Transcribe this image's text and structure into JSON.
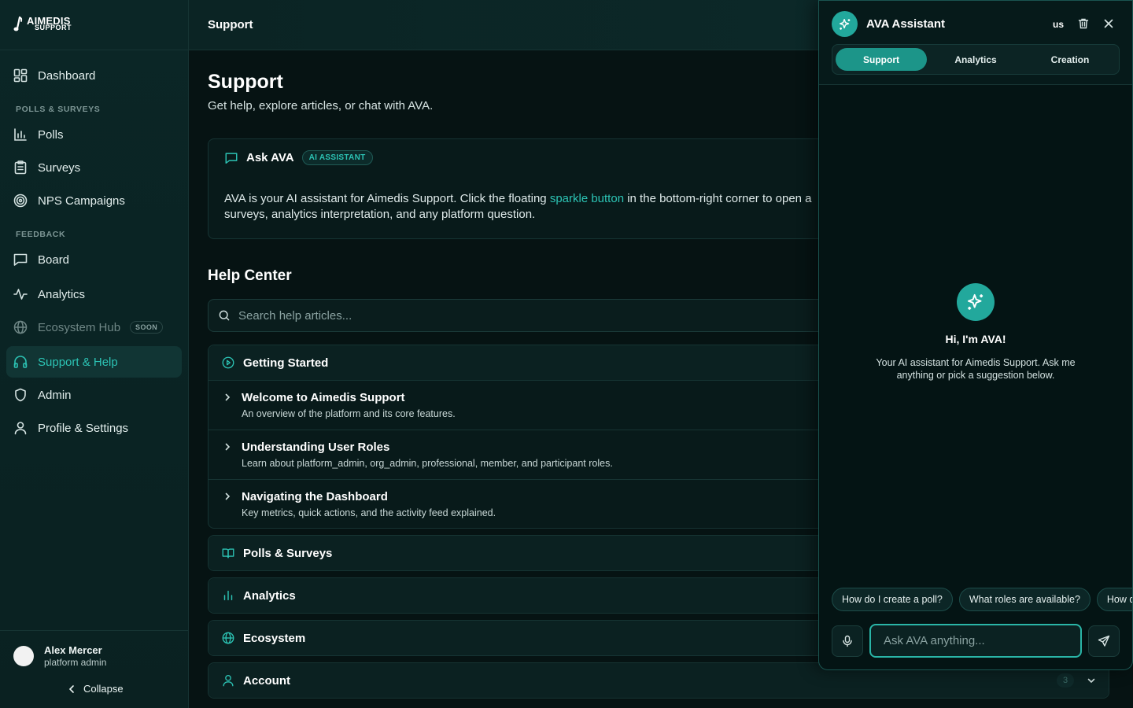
{
  "brand": {
    "line1": "AIMEDIS",
    "line2": "SUPPORT"
  },
  "sidebar": {
    "dashboard": "Dashboard",
    "section_polls": "POLLS & SURVEYS",
    "polls": "Polls",
    "surveys": "Surveys",
    "nps": "NPS Campaigns",
    "section_feedback": "FEEDBACK",
    "board": "Board",
    "analytics": "Analytics",
    "ecosystem": "Ecosystem Hub",
    "ecosystem_badge": "SOON",
    "support": "Support & Help",
    "admin": "Admin",
    "profile": "Profile & Settings"
  },
  "user": {
    "name": "Alex Mercer",
    "role": "platform admin"
  },
  "collapse_label": "Collapse",
  "topbar": {
    "title": "Support"
  },
  "page": {
    "title": "Support",
    "subtitle": "Get help, explore articles, or chat with AVA."
  },
  "ask": {
    "title": "Ask AVA",
    "badge": "AI ASSISTANT",
    "text_before": "AVA is your AI assistant for Aimedis Support. Click the floating ",
    "link": "sparkle button",
    "text_after": " in the bottom-right corner to open a",
    "line2": "surveys, analytics interpretation, and any platform question."
  },
  "help": {
    "title": "Help Center",
    "search_placeholder": "Search help articles...",
    "sections": [
      {
        "label": "Getting Started",
        "articles": [
          {
            "title": "Welcome to Aimedis Support",
            "desc": "An overview of the platform and its core features."
          },
          {
            "title": "Understanding User Roles",
            "desc": "Learn about platform_admin, org_admin, professional, member, and participant roles."
          },
          {
            "title": "Navigating the Dashboard",
            "desc": "Key metrics, quick actions, and the activity feed explained."
          }
        ]
      },
      {
        "label": "Polls & Surveys"
      },
      {
        "label": "Analytics"
      },
      {
        "label": "Ecosystem"
      },
      {
        "label": "Account",
        "count": "3"
      }
    ]
  },
  "ava": {
    "title": "AVA Assistant",
    "lang": "us",
    "tabs": [
      "Support",
      "Analytics",
      "Creation"
    ],
    "greeting": "Hi, I'm AVA!",
    "description": "Your AI assistant for Aimedis Support. Ask me anything or pick a suggestion below.",
    "suggestions": [
      "How do I create a poll?",
      "What roles are available?",
      "How do I"
    ],
    "input_placeholder": "Ask AVA anything..."
  },
  "colors": {
    "accent": "#2cc3b4",
    "accent_dark": "#1c9589",
    "background": "#061313",
    "sidebar": "#0b2626"
  }
}
